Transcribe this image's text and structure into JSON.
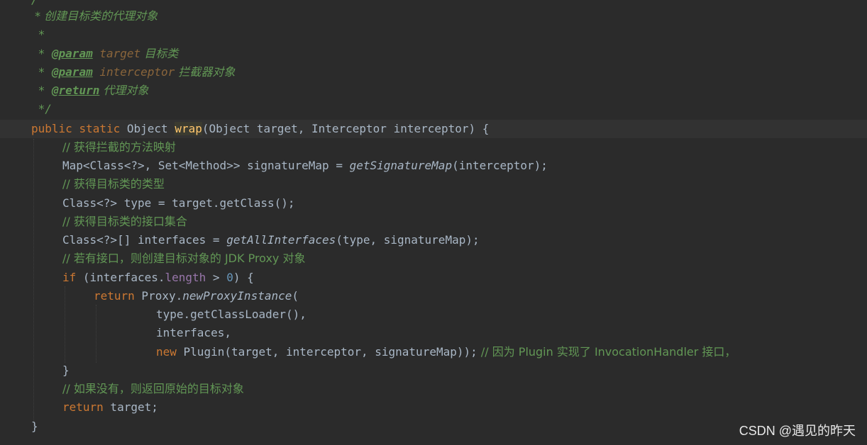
{
  "doc_comment": {
    "l0": "/",
    "l1": " * 创建目标类的代理对象",
    "l2": " *",
    "l3_star": " * ",
    "l3_tag": "@param",
    "l3_name": " target",
    "l3_desc": " 目标类",
    "l4_star": " * ",
    "l4_tag": "@param",
    "l4_name": " interceptor",
    "l4_desc": " 拦截器对象",
    "l5_star": " * ",
    "l5_tag": "@return",
    "l5_desc": " 代理对象",
    "l6": " */"
  },
  "code": {
    "sig_public": "public",
    "sig_static": "static",
    "sig_type": "Object",
    "sig_name": "wrap",
    "sig_params": "(Object target, Interceptor interceptor) {",
    "c1": "// 获得拦截的方法映射",
    "l2_a": "Map<Class<?>, Set<Method>> signatureMap = ",
    "l2_call": "getSignatureMap",
    "l2_b": "(interceptor);",
    "c3": "// 获得目标类的类型",
    "l4": "Class<?> type = target.getClass();",
    "c5": "// 获得目标类的接口集合",
    "l6_a": "Class<?>[] interfaces = ",
    "l6_call": "getAllInterfaces",
    "l6_b": "(type, signatureMap);",
    "c7": "// 若有接口，则创建目标对象的 JDK Proxy 对象",
    "l8_if": "if",
    "l8_a": " (interfaces.",
    "l8_field": "length",
    "l8_b": " > ",
    "l8_num": "0",
    "l8_c": ") {",
    "l9_return": "return",
    "l9_a": " Proxy.",
    "l9_call": "newProxyInstance",
    "l9_b": "(",
    "l10": "type.getClassLoader(),",
    "l11": "interfaces,",
    "l12_new": "new",
    "l12_a": " Plugin(target, interceptor, signatureMap));",
    "l12_cmt": " // 因为 Plugin 实现了 InvocationHandler 接口，",
    "l13": "}",
    "c14": "// 如果没有，则返回原始的目标对象",
    "l15_return": "return",
    "l15_a": " target;",
    "l16": "}"
  },
  "watermark": "CSDN @遇见的昨天",
  "colors": {
    "background": "#2b2b2b",
    "keyword": "#cc7832",
    "comment": "#629755",
    "method_decl": "#ffc66d",
    "field": "#9876aa",
    "number": "#6897bb",
    "text": "#a9b7c6"
  }
}
